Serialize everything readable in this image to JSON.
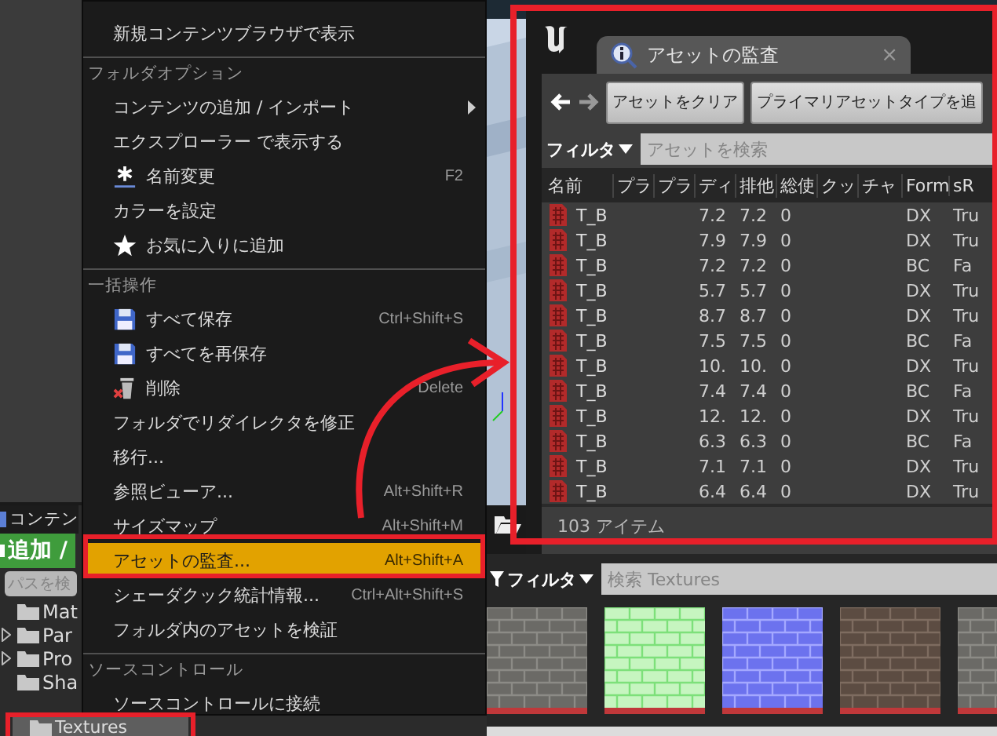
{
  "content_browser": {
    "tab": "コンテン",
    "add_button": "追加 /",
    "path_search": {
      "placeholder": "パスを検"
    },
    "folders": [
      {
        "label": "Mat",
        "expandable": false,
        "selected": false
      },
      {
        "label": "Par",
        "expandable": true,
        "selected": false
      },
      {
        "label": "Pro",
        "expandable": true,
        "selected": false
      },
      {
        "label": "Sha",
        "expandable": false,
        "selected": false
      },
      {
        "label": "Textures",
        "expandable": false,
        "selected": true
      }
    ]
  },
  "menu": {
    "items": [
      {
        "kind": "plain",
        "label": "新規コンテンツブラウザで表示",
        "selected": false
      },
      {
        "kind": "header",
        "label": "フォルダオプション"
      },
      {
        "kind": "submenu",
        "label": "コンテンツの追加 / インポート",
        "selected": false
      },
      {
        "kind": "plain",
        "label": "エクスプローラー で表示する",
        "selected": false
      },
      {
        "kind": "rename",
        "label": "名前変更",
        "shortcut": "F2",
        "selected": false
      },
      {
        "kind": "plain",
        "label": "カラーを設定",
        "selected": false
      },
      {
        "kind": "favorite",
        "label": "お気に入りに追加",
        "selected": false
      },
      {
        "kind": "header",
        "label": "一括操作"
      },
      {
        "kind": "save",
        "label": "すべて保存",
        "shortcut": "Ctrl+Shift+S",
        "selected": false
      },
      {
        "kind": "save",
        "label": "すべてを再保存",
        "selected": false
      },
      {
        "kind": "delete",
        "label": "削除",
        "shortcut": "Delete",
        "selected": false
      },
      {
        "kind": "plain",
        "label": "フォルダでリダイレクタを修正",
        "selected": false
      },
      {
        "kind": "plain",
        "label": "移行...",
        "selected": false
      },
      {
        "kind": "plain",
        "label": "参照ビューア...",
        "shortcut": "Alt+Shift+R",
        "selected": false
      },
      {
        "kind": "plain",
        "label": "サイズマップ",
        "shortcut": "Alt+Shift+M",
        "selected": false
      },
      {
        "kind": "plain",
        "label": "アセットの監査...",
        "shortcut": "Alt+Shift+A",
        "selected": true
      },
      {
        "kind": "plain",
        "label": "シェーダクック統計情報...",
        "shortcut": "Ctrl+Alt+Shift+S",
        "selected": false
      },
      {
        "kind": "plain",
        "label": "フォルダ内のアセットを検証",
        "selected": false
      },
      {
        "kind": "header",
        "label": "ソースコントロール"
      },
      {
        "kind": "plain",
        "label": "ソースコントロールに接続",
        "selected": false
      }
    ]
  },
  "audit_window": {
    "tab": {
      "label": "アセットの監査",
      "close": "×"
    },
    "buttons": [
      "アセットをクリア",
      "プライマリアセットタイプを追"
    ],
    "filter": {
      "label": "フィルタ",
      "placeholder": "アセットを検索"
    },
    "table": {
      "columns": [
        "名前",
        "プラ",
        "プラ",
        "ディ",
        "排他",
        "総使",
        "クッ",
        "チャ",
        "Form",
        "sR"
      ],
      "rows": [
        {
          "name": "T_B",
          "column_4": "7.2",
          "column_5": "7.2",
          "column_6": "0",
          "column_9": "DX",
          "column_10": "Tru"
        },
        {
          "name": "T_B",
          "column_4": "7.9",
          "column_5": "7.9",
          "column_6": "0",
          "column_9": "DX",
          "column_10": "Tru"
        },
        {
          "name": "T_B",
          "column_4": "7.2",
          "column_5": "7.2",
          "column_6": "0",
          "column_9": "BC",
          "column_10": "Fa"
        },
        {
          "name": "T_B",
          "column_4": "5.7",
          "column_5": "5.7",
          "column_6": "0",
          "column_9": "DX",
          "column_10": "Tru"
        },
        {
          "name": "T_B",
          "column_4": "8.7",
          "column_5": "8.7",
          "column_6": "0",
          "column_9": "DX",
          "column_10": "Tru"
        },
        {
          "name": "T_B",
          "column_4": "7.5",
          "column_5": "7.5",
          "column_6": "0",
          "column_9": "BC",
          "column_10": "Fa"
        },
        {
          "name": "T_B",
          "column_4": "10.",
          "column_5": "10.",
          "column_6": "0",
          "column_9": "DX",
          "column_10": "Tru"
        },
        {
          "name": "T_B",
          "column_4": "7.4",
          "column_5": "7.4",
          "column_6": "0",
          "column_9": "BC",
          "column_10": "Fa"
        },
        {
          "name": "T_B",
          "column_4": "12.",
          "column_5": "12.",
          "column_6": "0",
          "column_9": "DX",
          "column_10": "Tru"
        },
        {
          "name": "T_B",
          "column_4": "6.3",
          "column_5": "6.3",
          "column_6": "0",
          "column_9": "BC",
          "column_10": "Fa"
        },
        {
          "name": "T_B",
          "column_4": "7.1",
          "column_5": "7.1",
          "column_6": "0",
          "column_9": "DX",
          "column_10": "Tru"
        },
        {
          "name": "T_B",
          "column_4": "6.4",
          "column_5": "6.4",
          "column_6": "0",
          "column_9": "DX",
          "column_10": "Tru"
        }
      ]
    },
    "status": "103 アイテム"
  },
  "texture_browser": {
    "filter": {
      "label": "フィルタ",
      "placeholder": "検索 Textures"
    }
  }
}
